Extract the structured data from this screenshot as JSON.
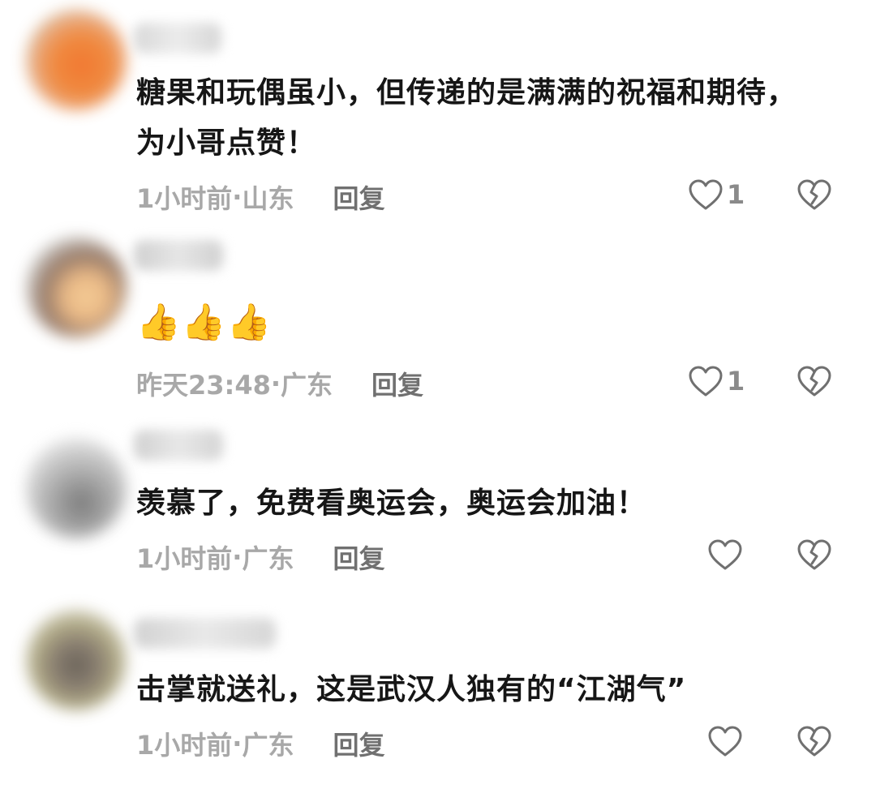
{
  "comments": [
    {
      "text_line1": "糖果和玩偶虽小，但传递的是满满的祝福和期待，",
      "text_line2": "为小哥点赞！",
      "time": "1小时前",
      "separator": " · ",
      "location": "山东",
      "reply_label": "回复",
      "likes": "1"
    },
    {
      "text_line1": "👍👍👍",
      "time": "昨天23:48",
      "separator": " · ",
      "location": "广东",
      "reply_label": "回复",
      "likes": "1"
    },
    {
      "text_line1": "羡慕了，免费看奥运会，奥运会加油！",
      "time": "1小时前",
      "separator": " · ",
      "location": "广东",
      "reply_label": "回复",
      "likes": ""
    },
    {
      "text_line1": "击掌就送礼，这是武汉人独有的“江湖气”",
      "time": "1小时前",
      "separator": " · ",
      "location": "广东",
      "reply_label": "回复",
      "likes": ""
    }
  ],
  "icons": {
    "like": "heart-outline-icon",
    "dislike": "broken-heart-icon"
  },
  "colors": {
    "text": "#161616",
    "meta": "#a8a8a8",
    "reply": "#707070",
    "icon": "#707070"
  }
}
